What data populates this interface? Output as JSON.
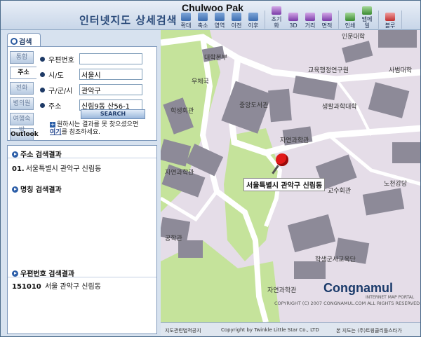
{
  "window_title": "Chulwoo Pak",
  "app_title": "인터넷지도 상세검색",
  "toolbar": {
    "groups": [
      [
        {
          "label": "확대",
          "icon": "zoom-in-icon"
        },
        {
          "label": "축소",
          "icon": "zoom-out-icon"
        },
        {
          "label": "영역",
          "icon": "area-select-icon"
        },
        {
          "label": "이전",
          "icon": "back-icon"
        },
        {
          "label": "이후",
          "icon": "forward-icon"
        }
      ],
      [
        {
          "label": "초기화",
          "icon": "reset-icon"
        },
        {
          "label": "3D",
          "icon": "3d-icon"
        },
        {
          "label": "거리",
          "icon": "distance-icon"
        },
        {
          "label": "면적",
          "icon": "measure-area-icon"
        }
      ],
      [
        {
          "label": "인쇄",
          "icon": "print-icon"
        },
        {
          "label": "맵메일",
          "icon": "mail-icon"
        }
      ],
      [
        {
          "label": "블루",
          "icon": "bookmark-icon"
        }
      ]
    ]
  },
  "search": {
    "tab_label": "검색",
    "side_tabs": [
      "통합",
      "주소",
      "전화",
      "병의원",
      "여행숙박",
      "Outlook"
    ],
    "active_side_tab": "주소",
    "fields": [
      {
        "label": "우편번호",
        "value": ""
      },
      {
        "label": "시/도",
        "value": "서울시"
      },
      {
        "label": "구/군/시",
        "value": "관악구"
      },
      {
        "label": "주소",
        "value": "신림9동 산56-1"
      }
    ],
    "button_label": "SEARCH",
    "help_text": "원하시는 결과를 못 찾으셨으면",
    "help_link": "여기",
    "help_suffix": "를 참조하세요."
  },
  "results": {
    "address": {
      "title": "주소 검색결과",
      "items": [
        {
          "no": "01.",
          "text": "서울특별시 관악구 신림동"
        }
      ]
    },
    "name": {
      "title": "명칭 검색결과"
    },
    "postal": {
      "title": "우편번호 검색결과",
      "items": [
        {
          "no": "151010",
          "text": "서울 관악구 신림동"
        }
      ]
    }
  },
  "map": {
    "callout": "서울특별시 관악구 신림동",
    "labels": [
      "인문대학",
      "대학본부",
      "우체국",
      "교육행정연구원",
      "사범대학",
      "중앙도서관",
      "생활과학대학",
      "학생회관",
      "자연과학관",
      "자연과학관",
      "노천강당",
      "교수회관",
      "공학관",
      "학생군사교육단",
      "자연과학관"
    ],
    "brand": "Congnamul",
    "brand_sub": "INTERNET MAP PORTAL",
    "copyright": "COPYRIGHT (C) 2007 CONGNAMUL.COM ALL RIGHTS RESERVED."
  },
  "footer": {
    "notice": "지도관련법적공지",
    "company": "Copyright by Twinkle Little Star Co., LTD",
    "note": "본 지도는 (주)트윙클리틀스타가"
  },
  "colors": {
    "map_bg": "#e5dde8",
    "road": "#ffffff",
    "park": "#c5e39b",
    "building": "#8d8a98",
    "accent": "#2a4a7a"
  }
}
